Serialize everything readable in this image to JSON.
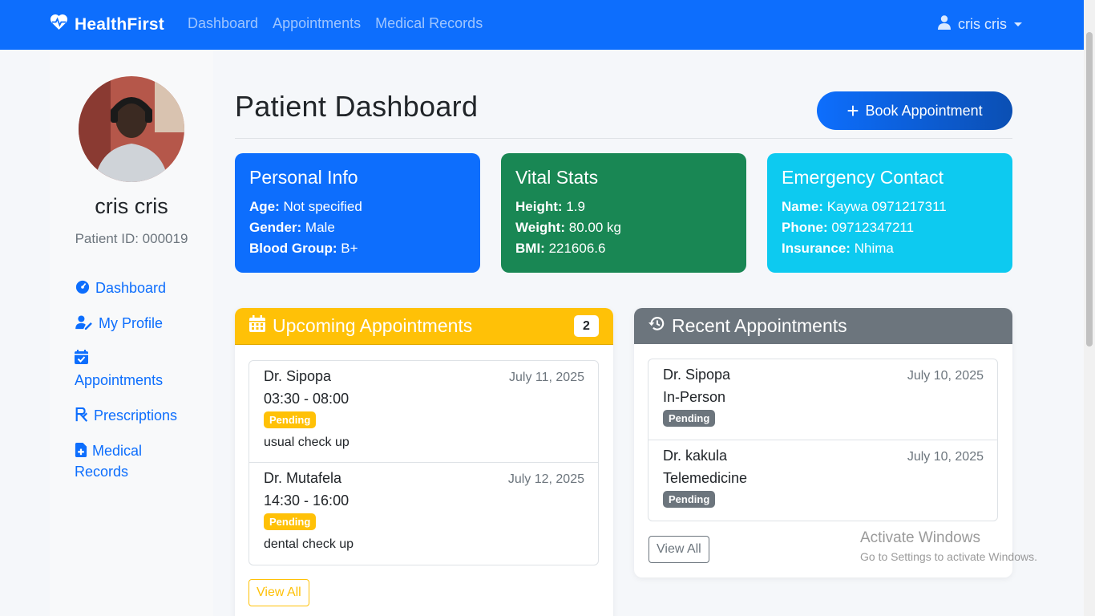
{
  "navbar": {
    "brand": "HealthFirst",
    "links": [
      "Dashboard",
      "Appointments",
      "Medical Records"
    ],
    "user": "cris cris"
  },
  "sidebar": {
    "name": "cris cris",
    "patient_id": "Patient ID: 000019",
    "items": [
      {
        "label": "Dashboard",
        "icon": "dashboard-gauge-icon"
      },
      {
        "label": "My Profile",
        "icon": "user-edit-icon"
      },
      {
        "label": "Appointments",
        "icon": "calendar-check-icon"
      },
      {
        "label": "Prescriptions",
        "icon": "prescription-icon"
      },
      {
        "label": "Medical Records",
        "icon": "medical-file-icon"
      }
    ]
  },
  "main": {
    "title": "Patient Dashboard",
    "book_button": "Book Appointment"
  },
  "personal": {
    "title": "Personal Info",
    "age_label": "Age:",
    "age": "Not specified",
    "gender_label": "Gender:",
    "gender": "Male",
    "blood_label": "Blood Group:",
    "blood": "B+"
  },
  "vitals": {
    "title": "Vital Stats",
    "height_label": "Height:",
    "height": "1.9",
    "weight_label": "Weight:",
    "weight": "80.00 kg",
    "bmi_label": "BMI:",
    "bmi": "221606.6"
  },
  "emergency": {
    "title": "Emergency Contact",
    "name_label": "Name:",
    "name": "Kaywa 0971217311",
    "phone_label": "Phone:",
    "phone": "09712347211",
    "insurance_label": "Insurance:",
    "insurance": "Nhima"
  },
  "upcoming": {
    "title": "Upcoming Appointments",
    "count": "2",
    "items": [
      {
        "doctor": "Dr. Sipopa",
        "date": "July 11, 2025",
        "time": "03:30 - 08:00",
        "status": "Pending",
        "note": "usual check up"
      },
      {
        "doctor": "Dr. Mutafela",
        "date": "July 12, 2025",
        "time": "14:30 - 16:00",
        "status": "Pending",
        "note": "dental check up"
      }
    ],
    "view_all": "View All"
  },
  "recent": {
    "title": "Recent Appointments",
    "items": [
      {
        "doctor": "Dr. Sipopa",
        "date": "July 10, 2025",
        "type": "In-Person",
        "status": "Pending"
      },
      {
        "doctor": "Dr. kakula",
        "date": "July 10, 2025",
        "type": "Telemedicine",
        "status": "Pending"
      }
    ],
    "view_all": "View All"
  },
  "watermark": {
    "line1": "Activate Windows",
    "line2": "Go to Settings to activate Windows."
  },
  "colors": {
    "primary": "#0d6efd",
    "success": "#198754",
    "info": "#0dcaf0",
    "warning": "#ffc107",
    "secondary": "#6c757d"
  }
}
